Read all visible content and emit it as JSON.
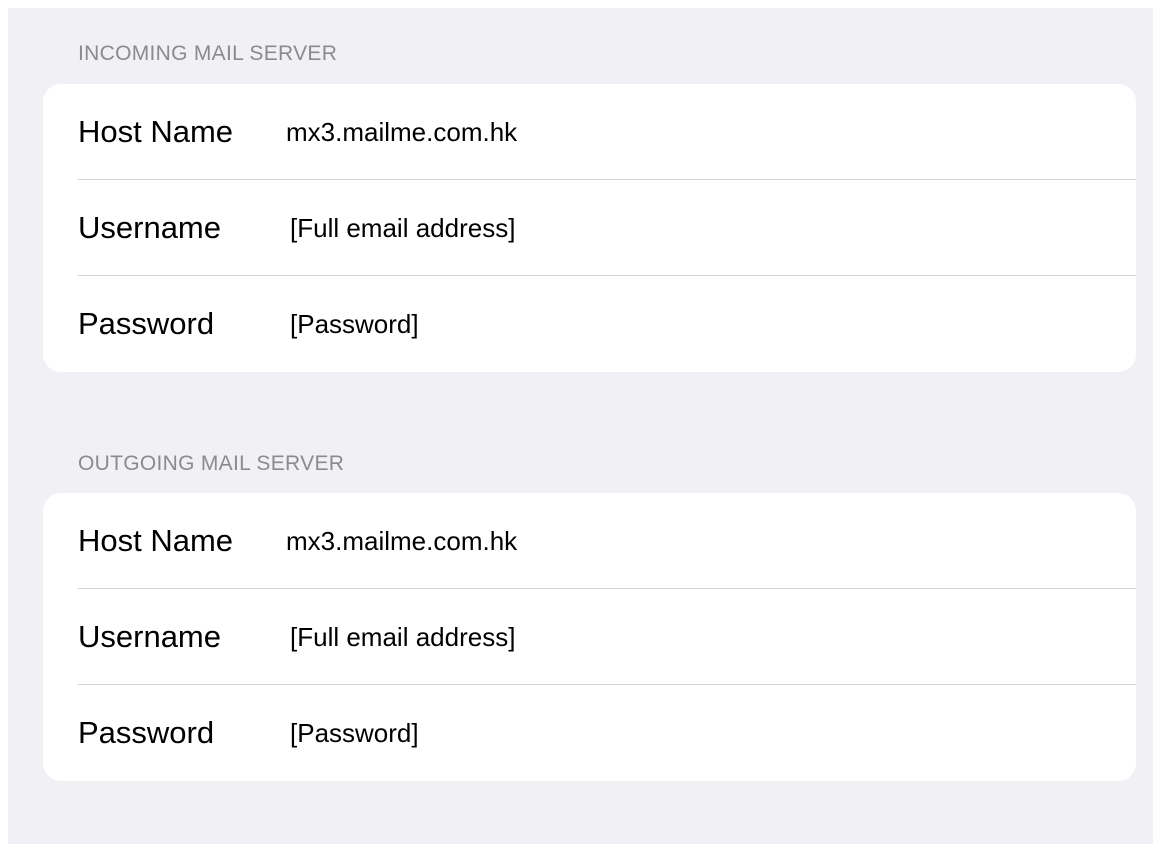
{
  "incoming": {
    "header": "INCOMING MAIL SERVER",
    "host_name_label": "Host Name",
    "host_name_value": "mx3.mailme.com.hk",
    "username_label": "Username",
    "username_value": "[Full email address]",
    "password_label": "Password",
    "password_value": "[Password]"
  },
  "outgoing": {
    "header": "OUTGOING MAIL SERVER",
    "host_name_label": "Host Name",
    "host_name_value": "mx3.mailme.com.hk",
    "username_label": "Username",
    "username_value": "[Full email address]",
    "password_label": "Password",
    "password_value": "[Password]"
  },
  "colors": {
    "background": "#f1f1f5",
    "card": "#ffffff",
    "section_header": "#8a8a8f",
    "separator": "#d1d1d6",
    "text": "#000000"
  }
}
